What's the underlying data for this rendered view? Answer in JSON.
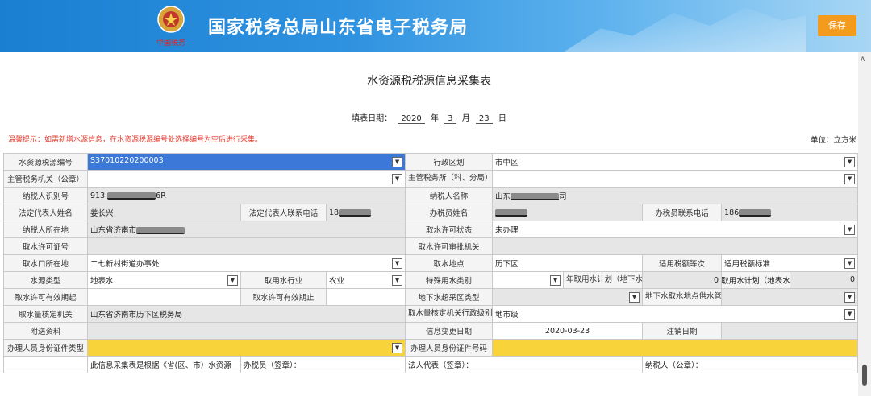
{
  "header": {
    "title": "国家税务总局山东省电子税务局",
    "save_label": "保存"
  },
  "form": {
    "title": "水资源税税源信息采集表",
    "date_label": "填表日期：",
    "year": "2020",
    "year_unit": "年",
    "month": "3",
    "month_unit": "月",
    "day": "23",
    "day_unit": "日",
    "hint": "温馨提示：如需新增水源信息，在水资源税源编号处选择编号为空后进行采集。",
    "unit": "单位：立方米"
  },
  "rows": {
    "r1": {
      "l1": "水资源税源编号",
      "v1": "S37010220200003",
      "l2": "行政区划",
      "v2": "市中区"
    },
    "r2": {
      "l1": "主管税务机关（公章）",
      "v1": "",
      "l2": "主管税务所（科、分局）",
      "v2": ""
    },
    "r3": {
      "l1": "纳税人识别号",
      "v1a": "913",
      "v1b": "6R",
      "l2": "纳税人名称",
      "v2a": "山东",
      "v2b": "司"
    },
    "r4": {
      "l1": "法定代表人姓名",
      "v1": "姜长兴",
      "l2": "法定代表人联系电话",
      "v2": "18",
      "l3": "办税员姓名",
      "v3": "",
      "l4": "办税员联系电话",
      "v4": "186"
    },
    "r5": {
      "l1": "纳税人所在地",
      "v1": "山东省济南市",
      "l2": "取水许可状态",
      "v2": "未办理"
    },
    "r6": {
      "l1": "取水许可证号",
      "v1": "",
      "l2": "取水许可审批机关",
      "v2": ""
    },
    "r7": {
      "l1": "取水口所在地",
      "v1": "二七新村街道办事处",
      "l2": "取水地点",
      "v2": "历下区",
      "l3": "适用税额等次",
      "v3": "适用税额标准"
    },
    "r8": {
      "l1": "水源类型",
      "v1": "地表水",
      "l2": "取用水行业",
      "v2": "农业",
      "l3": "特殊用水类别",
      "v3": "",
      "l4": "年取用水计划（地下水）",
      "v4": "0",
      "l5": "年取用水计划（地表水）",
      "v5": "0"
    },
    "r9": {
      "l1": "取水许可有效期起",
      "v1": "",
      "l2": "取水许可有效期止",
      "v2": "",
      "l3": "地下水超采区类型",
      "v3": "",
      "l4": "地下水取水地点供水管网是否覆盖",
      "v4": ""
    },
    "r10": {
      "l1": "取水量核定机关",
      "v1": "山东省济南市历下区税务局",
      "l2": "取水量核定机关行政级别",
      "v2": "地市级"
    },
    "r11": {
      "l1": "附送资料",
      "v1": "",
      "l2": "信息变更日期",
      "v2": "2020-03-23",
      "l3": "注销日期",
      "v3": ""
    },
    "r12": {
      "l1": "办理人员身份证件类型",
      "v1": "",
      "l2": "办理人员身份证件号码",
      "v2": ""
    },
    "r13": {
      "c1": "此信息采集表是根据《省(区、市）水资源",
      "c2": "办税员（签章）：",
      "c3": "法人代表（签章）：",
      "c4": "纳税人（公章）："
    }
  },
  "colors": {
    "header_blue": "#1a7fd1",
    "save_orange": "#f49a1c",
    "hint_red": "#e23b2e",
    "required_yellow": "#f8d43a",
    "selected_blue": "#3c78d8"
  }
}
